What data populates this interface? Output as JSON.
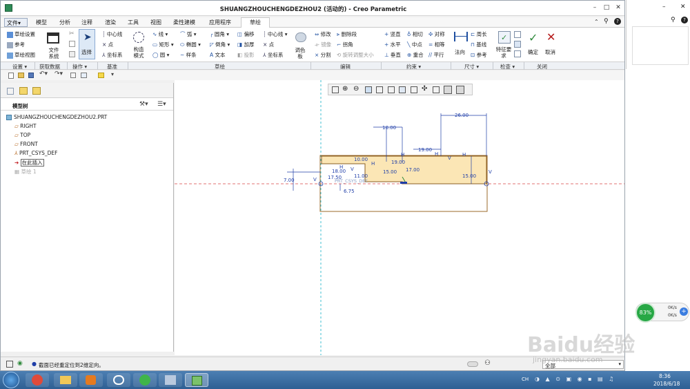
{
  "window": {
    "title": "SHUANGZHOUCHENGDEZHOU2 (活动的) - Creo Parametric",
    "controls": [
      "–",
      "□",
      "✕"
    ]
  },
  "menu": {
    "file": "文件▾",
    "tabs": [
      "模型",
      "分析",
      "注释",
      "渲染",
      "工具",
      "视图",
      "柔性建模",
      "应用程序"
    ],
    "active_tab": "草绘"
  },
  "ribbon": {
    "setup": {
      "sketch_setup": "草绘设置",
      "reference": "参考",
      "sketch_view": "草绘视图",
      "file_system": "文件系统"
    },
    "operations": {
      "select": "选择"
    },
    "datum": {
      "centerline": "中心线",
      "point": "点",
      "coord_sys": "坐标系"
    },
    "sketching": {
      "construction_mode": "构造模式",
      "line": "线",
      "rectangle": "矩形",
      "circle": "圆",
      "arc": "弧",
      "ellipse": "椭圆",
      "spline": "样条",
      "fillet": "圆角",
      "chamfer": "倒角",
      "text": "文本",
      "offset": "偏移",
      "thicken": "加厚",
      "project": "投影",
      "centerline": "中心线",
      "point": "点",
      "coord_sys": "坐标系",
      "palette": "调色板"
    },
    "editing": {
      "modify": "修改",
      "delete_segment": "删除段",
      "mirror": "镜像",
      "corner": "拐角",
      "divide": "分割",
      "rotate_resize": "旋转调整大小"
    },
    "constrain": {
      "vertical": "竖直",
      "tangent": "相切",
      "symmetric": "对称",
      "horizontal": "水平",
      "midpoint": "中点",
      "equal": "相等",
      "perpendicular": "垂直",
      "coincident": "重合",
      "parallel": "平行"
    },
    "dimension": {
      "normal": "法向",
      "perimeter": "周长",
      "baseline": "基线",
      "reference": "参考"
    },
    "inspect": {
      "feature_req": "特征要求"
    },
    "close": {
      "ok": "确定",
      "cancel": "取消"
    }
  },
  "groups": [
    "设置 ▾",
    "获取数据",
    "操作 ▾",
    "基准",
    "草绘",
    "编辑",
    "约束 ▾",
    "尺寸 ▾",
    "检查 ▾",
    "关闭"
  ],
  "model_tree": {
    "header": "模型树",
    "root": "SHUANGZHOUCHENGDEZHOU2.PRT",
    "items": [
      "RIGHT",
      "TOP",
      "FRONT",
      "PRT_CSYS_DEF",
      "在此插入",
      "草绘 1"
    ]
  },
  "sketch": {
    "dimensions": [
      "26.00",
      "19.00",
      "10.00",
      "19.00",
      "10.00",
      "18.00",
      "15.00",
      "17.00",
      "15.00",
      "11.00",
      "7.00",
      "6.75",
      "17.50"
    ],
    "csys_label": "PRT_CSYS_DEF"
  },
  "status": {
    "message": "截面已经重定位到2维定向。",
    "filter": "全部"
  },
  "taskbar": {
    "time": "8:36",
    "date": "2018/6/18",
    "lang": "CH"
  },
  "widget": {
    "percent": "83%",
    "up": "0K/s",
    "down": "0K/s"
  },
  "watermark": {
    "brand": "Baidu经验",
    "url": "jingyan.baidu.com"
  },
  "colors": {
    "sketch_fill": "#fbe6b5",
    "dimension": "#1f3ea8",
    "accent": "#2f8a3c"
  }
}
